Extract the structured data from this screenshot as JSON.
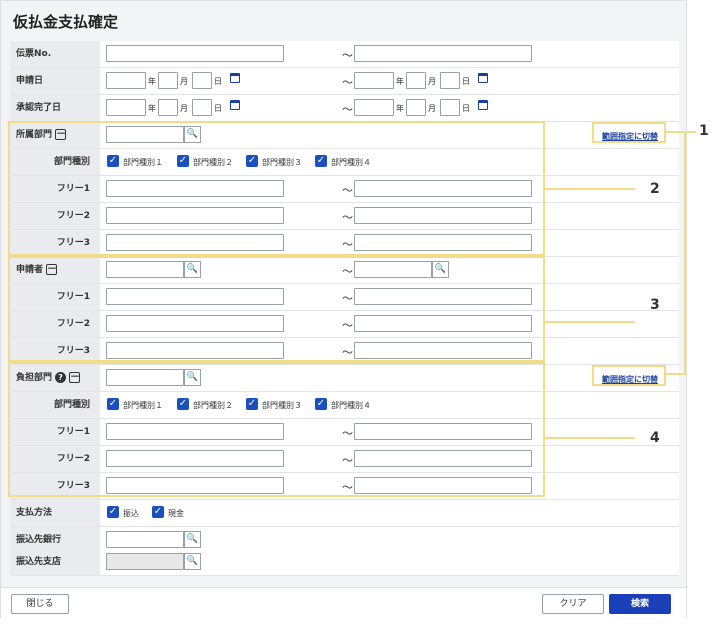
{
  "title": "仮払金支払確定",
  "tilde": "～",
  "date_units": {
    "year": "年",
    "month": "月",
    "day": "日"
  },
  "labels": {
    "voucher_no": "伝票No.",
    "apply_date": "申請日",
    "approval_date": "承認完了日",
    "dept": "所属部門",
    "dept_type": "部門種別",
    "free1": "フリー1",
    "free2": "フリー2",
    "free3": "フリー3",
    "applicant": "申請者",
    "burden_dept": "負担部門",
    "pay_method": "支払方法",
    "bank": "振込先銀行",
    "branch": "振込先支店"
  },
  "dept_types": [
    "部門種別１",
    "部門種別２",
    "部門種別３",
    "部門種別４"
  ],
  "pay_methods": [
    "振込",
    "現金"
  ],
  "range_toggle_label": "範囲指定に切替",
  "minus": "－",
  "help": "?",
  "check": "✓",
  "search": "🔍",
  "callouts": [
    "1",
    "2",
    "3",
    "4"
  ],
  "buttons": {
    "close": "閉じる",
    "clear": "クリア",
    "search": "検索"
  },
  "colors": {
    "accent": "#1a3fb8",
    "highlight": "#f3dc89",
    "label_bg": "#e9ebef"
  }
}
